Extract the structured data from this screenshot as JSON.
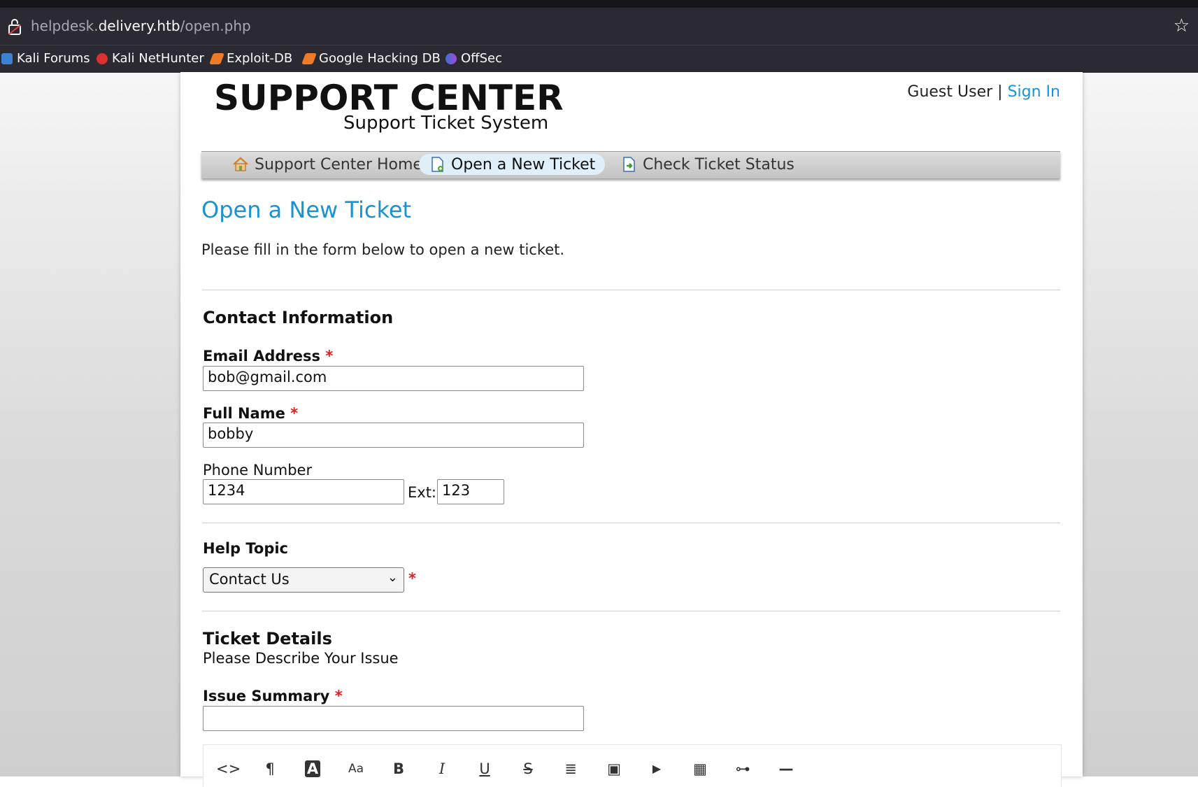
{
  "browser": {
    "url_prefix": "helpdesk.",
    "url_host": "delivery.htb",
    "url_path": "/open.php",
    "bookmarks": [
      "Kali Forums",
      "Kali NetHunter",
      "Exploit-DB",
      "Google Hacking DB",
      "OffSec"
    ]
  },
  "header": {
    "title": "SUPPORT CENTER",
    "subtitle": "Support Ticket System",
    "guest_label": "Guest User",
    "separator": "|",
    "sign_in": "Sign In"
  },
  "nav": {
    "items": [
      {
        "label": "Support Center Home",
        "icon": "home-icon"
      },
      {
        "label": "Open a New Ticket",
        "icon": "new-ticket-icon",
        "active": true
      },
      {
        "label": "Check Ticket Status",
        "icon": "ticket-status-icon"
      }
    ]
  },
  "main": {
    "heading": "Open a New Ticket",
    "intro": "Please fill in the form below to open a new ticket."
  },
  "contact": {
    "section_title": "Contact Information",
    "email_label": "Email Address",
    "email_value": "bob@gmail.com",
    "name_label": "Full Name",
    "name_value": "bobby",
    "phone_label": "Phone Number",
    "phone_value": "1234",
    "ext_label": "Ext:",
    "ext_value": "123",
    "required_mark": "*"
  },
  "help_topic": {
    "label": "Help Topic",
    "selected": "Contact Us"
  },
  "ticket": {
    "section_title": "Ticket Details",
    "subtitle": "Please Describe Your Issue",
    "summary_label": "Issue Summary",
    "summary_value": ""
  },
  "editor_toolbar": [
    {
      "glyph": "<>",
      "icon": "code-icon"
    },
    {
      "glyph": "¶",
      "icon": "paragraph-icon"
    },
    {
      "glyph": "A",
      "icon": "font-color-icon"
    },
    {
      "glyph": "Aa",
      "icon": "font-size-icon"
    },
    {
      "glyph": "B",
      "icon": "bold-icon"
    },
    {
      "glyph": "I",
      "icon": "italic-icon"
    },
    {
      "glyph": "U",
      "icon": "underline-icon"
    },
    {
      "glyph": "S",
      "icon": "strikethrough-icon"
    },
    {
      "glyph": "≣",
      "icon": "list-icon"
    },
    {
      "glyph": "▣",
      "icon": "image-icon"
    },
    {
      "glyph": "▶",
      "icon": "video-icon"
    },
    {
      "glyph": "▦",
      "icon": "table-icon"
    },
    {
      "glyph": "⊶",
      "icon": "link-icon"
    },
    {
      "glyph": "—",
      "icon": "horizontal-rule-icon"
    }
  ],
  "colors": {
    "accent": "#1a93d6",
    "required": "#e02020",
    "browser_chrome": "#2b2a33"
  }
}
